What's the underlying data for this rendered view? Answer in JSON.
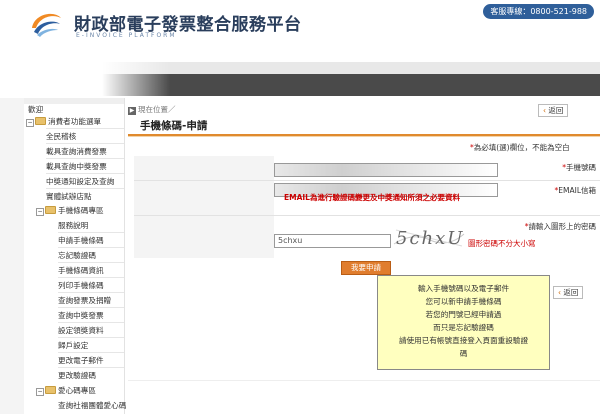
{
  "header": {
    "title": "財政部電子發票整合服務平台",
    "subtitle": "E-INVOICE PLATFORM",
    "hotline": "客服專線：0800-521-988"
  },
  "sidebar": {
    "home": "歡迎",
    "groups": [
      {
        "title": "消費者功能選單",
        "items": [
          "全民稽核",
          "載具查詢消費發票",
          "載具查詢中獎發票",
          "中獎通知設定及查詢",
          "實體試辦店點"
        ]
      },
      {
        "title": "手機條碼專區",
        "items": [
          "服務說明",
          "申請手機條碼",
          "忘記驗證碼",
          "手機條碼資訊",
          "列印手機條碼",
          "查詢發票及捐贈",
          "查詢中獎發票",
          "設定領獎資料",
          "歸戶設定",
          "更改電子郵件",
          "更改驗證碼"
        ]
      },
      {
        "title": "愛心碼專區",
        "items": [
          "查詢社福團體愛心碼"
        ]
      }
    ]
  },
  "breadcrumb": "現在位置／",
  "page_title": "手機條碼-申請",
  "back_label": "返回",
  "required_note": "為必填(選)欄位，不能為空白",
  "form": {
    "phone_label": "手機號碼",
    "email_label": "EMAIL信箱",
    "email_note": "EMAIL為進行驗證碼變更及中獎通知所須之必要資料",
    "captcha_label": "請輸入圖形上的密碼",
    "captcha_value": "5chxu",
    "captcha_image_text": "5chxU",
    "captcha_note": "圖形密碼不分大小寫",
    "submit_label": "我要申請"
  },
  "tooltip": {
    "lines": [
      "輸入手機號碼以及電子郵件",
      "您可以新申請手機條碼",
      "若您的門號已經申請過",
      "而只是忘記驗證碼",
      "請使用已有帳號直接登入頁面重設驗證",
      "碼"
    ]
  },
  "colors": {
    "accent": "#e07d2e",
    "required": "#cc0000",
    "tooltip_bg": "#ffffbf",
    "banner_dark": "#4a4a4a"
  }
}
